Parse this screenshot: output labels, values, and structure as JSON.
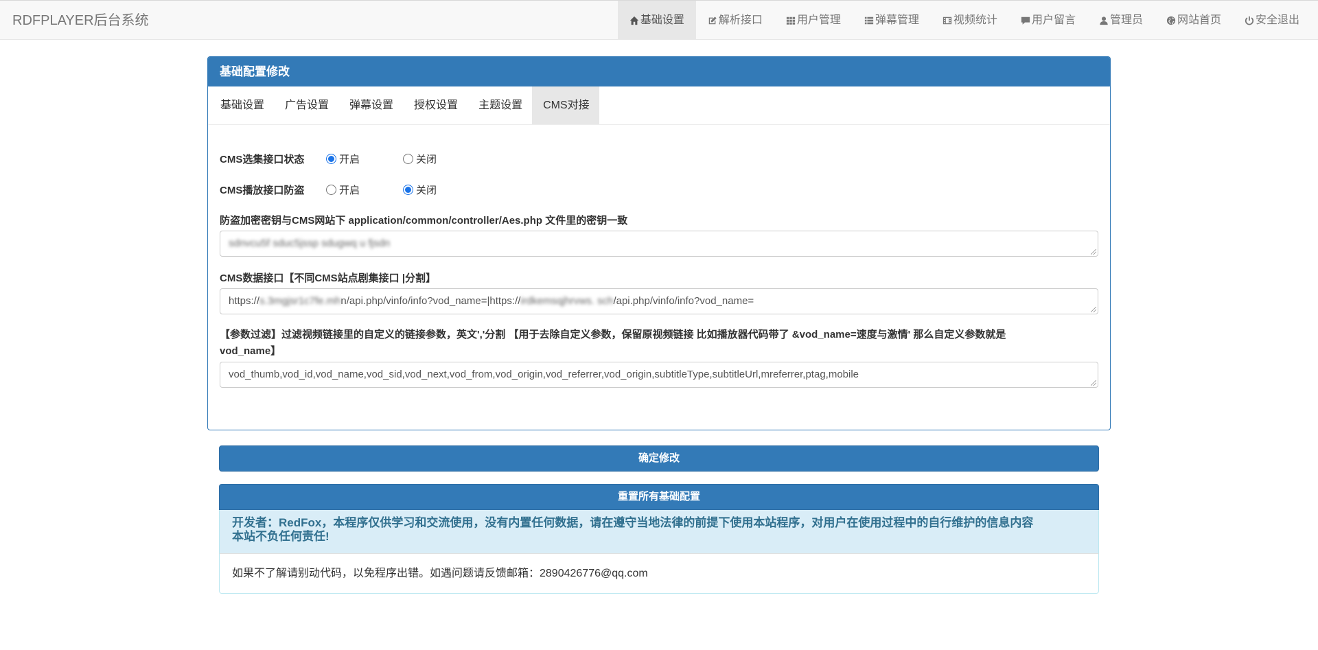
{
  "app": {
    "brand": "RDFPLAYER后台系统"
  },
  "nav": {
    "items": [
      {
        "label": "基础设置",
        "icon": "home-icon",
        "active": true
      },
      {
        "label": "解析接口",
        "icon": "edit-icon"
      },
      {
        "label": "用户管理",
        "icon": "grid-icon"
      },
      {
        "label": "弹幕管理",
        "icon": "list-icon"
      },
      {
        "label": "视频统计",
        "icon": "film-icon"
      },
      {
        "label": "用户留言",
        "icon": "comment-icon"
      },
      {
        "label": "管理员",
        "icon": "user-icon"
      },
      {
        "label": "网站首页",
        "icon": "globe-icon"
      },
      {
        "label": "安全退出",
        "icon": "power-icon"
      }
    ]
  },
  "panel": {
    "title": "基础配置修改",
    "tabs": [
      "基础设置",
      "广告设置",
      "弹幕设置",
      "授权设置",
      "主题设置",
      "CMS对接"
    ],
    "active_tab": "CMS对接"
  },
  "form": {
    "collect_status": {
      "label": "CMS选集接口状态",
      "on": "开启",
      "off": "关闭",
      "value": "on"
    },
    "play_protect": {
      "label": "CMS播放接口防盗",
      "on": "开启",
      "off": "关闭",
      "value": "off"
    },
    "aes_key": {
      "label": "防盗加密密钥与CMS网站下 application/common/controller/Aes.php 文件里的密钥一致",
      "value": "sdnvcu5f sduc5jssp sdugwq u fjsdn"
    },
    "data_api": {
      "label": "CMS数据接口【不同CMS站点剧集接口 |分割】",
      "prefix1": "https://",
      "blur1": "s.3mgjsr1c7fe.mh",
      "mid": "n/api.php/vinfo/info?vod_name=|https://",
      "blur2": "irdkemsqjhrvws. sch",
      "suffix": "/api.php/vinfo/info?vod_name="
    },
    "param_filter": {
      "label_line1": "【参数过滤】过滤视频链接里的自定义的链接参数，英文','分割 【用于去除自定义参数，保留原视频链接 比如播放器代码带了 &vod_name=速度与激情' 那么自定义参数就是",
      "label_line2": "vod_name】",
      "value": "vod_thumb,vod_id,vod_name,vod_sid,vod_next,vod_from,vod_origin,vod_referrer,vod_origin,subtitleType,subtitleUrl,mreferrer,ptag,mobile"
    }
  },
  "buttons": {
    "confirm": "确定修改",
    "reset": "重置所有基础配置"
  },
  "footer": {
    "alert_line1": "开发者：RedFox，本程序仅供学习和交流使用，没有内置任何数据，请在遵守当地法律的前提下使用本站程序，对用户在使用过程中的自行维护的信息内容",
    "alert_line2": "本站不负任何责任!",
    "note": "如果不了解请别动代码，以免程序出错。如遇问题请反馈邮箱：2890426776@qq.com"
  }
}
